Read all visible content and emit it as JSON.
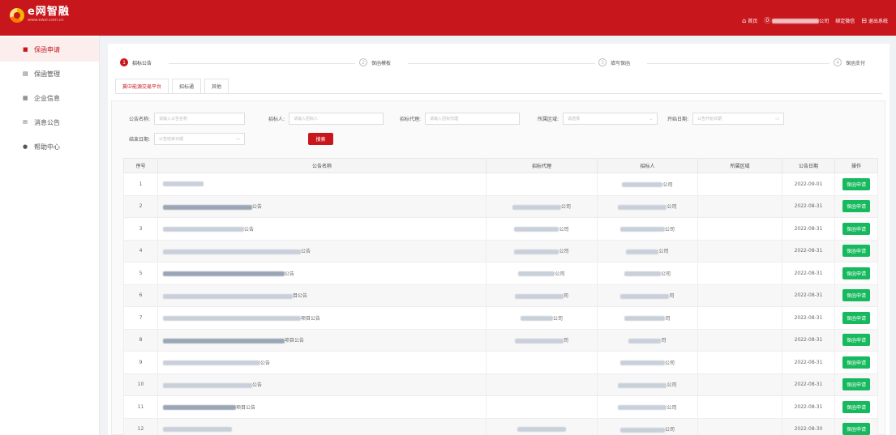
{
  "brand": {
    "name": "e网智融",
    "url": "www.ewzr.com.cn"
  },
  "topbar": {
    "home": "首页",
    "company": "公司",
    "wechat": "绑定微信",
    "logout": "退出系统"
  },
  "sidebar": {
    "items": [
      {
        "label": "保函申请",
        "icon": "■"
      },
      {
        "label": "保函管理",
        "icon": "▤"
      },
      {
        "label": "企业信息",
        "icon": "▦"
      },
      {
        "label": "消息公告",
        "icon": "✉"
      },
      {
        "label": "帮助中心",
        "icon": "●"
      }
    ]
  },
  "steps": [
    {
      "num": "1",
      "label": "招标公告"
    },
    {
      "num": "2",
      "label": "保函模板"
    },
    {
      "num": "3",
      "label": "填写保函"
    },
    {
      "num": "4",
      "label": "保函支付"
    }
  ],
  "tabs": [
    "冀中能源交易平台",
    "招标通",
    "其他"
  ],
  "filters": {
    "name_label": "公告名称:",
    "name_ph": "请输入公告名称",
    "tenderer_label": "招标人:",
    "tenderer_ph": "请输入招标人",
    "agent_label": "招标代理:",
    "agent_ph": "请输入招标代理",
    "region_label": "所属区域:",
    "region_ph": "请选择",
    "start_label": "开始日期:",
    "start_ph": "公告开始日期",
    "end_label": "结束日期:",
    "end_ph": "公告结束日期",
    "search": "搜索"
  },
  "table": {
    "headers": [
      "序号",
      "公告名称",
      "招标代理",
      "招标人",
      "所属区域",
      "公告日期",
      "操作"
    ],
    "action_label": "保函申请",
    "rows": [
      {
        "no": "1",
        "name_suffix": "",
        "agent_suffix": "",
        "tenderer_suffix": "公司",
        "date": "2022-09-01"
      },
      {
        "no": "2",
        "name_suffix": "公告",
        "agent_suffix": "公司",
        "tenderer_suffix": "公司",
        "date": "2022-08-31"
      },
      {
        "no": "3",
        "name_suffix": "公告",
        "agent_suffix": "公司",
        "tenderer_suffix": "公司",
        "date": "2022-08-31"
      },
      {
        "no": "4",
        "name_suffix": "公告",
        "agent_suffix": "公司",
        "tenderer_suffix": "公司",
        "date": "2022-08-31"
      },
      {
        "no": "5",
        "name_suffix": "公告",
        "agent_suffix": "公司",
        "tenderer_suffix": "公司",
        "date": "2022-08-31"
      },
      {
        "no": "6",
        "name_suffix": "目公告",
        "agent_suffix": "司",
        "tenderer_suffix": "司",
        "date": "2022-08-31"
      },
      {
        "no": "7",
        "name_suffix": "项目公告",
        "agent_suffix": "公司",
        "tenderer_suffix": "司",
        "date": "2022-08-31"
      },
      {
        "no": "8",
        "name_suffix": "项目公告",
        "agent_suffix": "司",
        "tenderer_suffix": "司",
        "date": "2022-08-31"
      },
      {
        "no": "9",
        "name_suffix": "公告",
        "agent_suffix": "",
        "tenderer_suffix": "公司",
        "date": "2022-08-31"
      },
      {
        "no": "10",
        "name_suffix": "公告",
        "agent_suffix": "",
        "tenderer_suffix": "公司",
        "date": "2022-08-31"
      },
      {
        "no": "11",
        "name_suffix": "项目公告",
        "agent_suffix": "",
        "tenderer_suffix": "公司",
        "date": "2022-08-31"
      },
      {
        "no": "12",
        "name_suffix": "",
        "agent_suffix": "",
        "tenderer_suffix": "公司",
        "date": "2022-08-30"
      }
    ]
  },
  "colors": {
    "brand_red": "#c8161d",
    "action_green": "#17b95f"
  }
}
